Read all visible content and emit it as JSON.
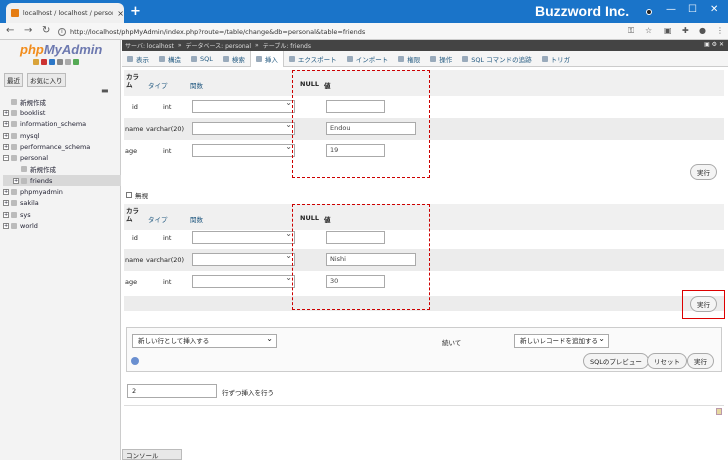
{
  "browser": {
    "tab_title": "localhost / localhost / personal /",
    "url": "http://localhost/phpMyAdmin/index.php?route=/table/change&db=personal&table=friends",
    "brand": "Buzzword Inc."
  },
  "sidebar": {
    "logo_php": "php",
    "logo_admin": "MyAdmin",
    "recent": "最近",
    "favorites": "お気に入り",
    "tree": [
      {
        "label": "新規作成",
        "level": 0,
        "pm": "",
        "selected": false
      },
      {
        "label": "booklist",
        "level": 0,
        "pm": "+",
        "selected": false
      },
      {
        "label": "information_schema",
        "level": 0,
        "pm": "+",
        "selected": false
      },
      {
        "label": "mysql",
        "level": 0,
        "pm": "+",
        "selected": false
      },
      {
        "label": "performance_schema",
        "level": 0,
        "pm": "+",
        "selected": false
      },
      {
        "label": "personal",
        "level": 0,
        "pm": "−",
        "selected": false
      },
      {
        "label": "新規作成",
        "level": 1,
        "pm": "",
        "selected": false
      },
      {
        "label": "friends",
        "level": 1,
        "pm": "+",
        "selected": true
      },
      {
        "label": "phpmyadmin",
        "level": 0,
        "pm": "+",
        "selected": false
      },
      {
        "label": "sakila",
        "level": 0,
        "pm": "+",
        "selected": false
      },
      {
        "label": "sys",
        "level": 0,
        "pm": "+",
        "selected": false
      },
      {
        "label": "world",
        "level": 0,
        "pm": "+",
        "selected": false
      }
    ]
  },
  "breadcrumb": {
    "server": "サーバ: localhost",
    "db": "データベース: personal",
    "table": "テーブル: friends"
  },
  "tabs": [
    "表示",
    "構造",
    "SQL",
    "検索",
    "挿入",
    "エクスポート",
    "インポート",
    "権限",
    "操作",
    "SQL コマンドの追跡",
    "トリガ"
  ],
  "form": {
    "col_header": "カラム",
    "type_header": "タイプ",
    "func_header": "関数",
    "null_header": "NULL",
    "value_header": "値",
    "execute": "実行",
    "ignore": "無視",
    "rows1": [
      {
        "name": "id",
        "type": "int",
        "value": ""
      },
      {
        "name": "name",
        "type": "varchar(20)",
        "value": "Endou"
      },
      {
        "name": "age",
        "type": "int",
        "value": "19"
      }
    ],
    "rows2": [
      {
        "name": "id",
        "type": "int",
        "value": ""
      },
      {
        "name": "name",
        "type": "varchar(20)",
        "value": "Nishi"
      },
      {
        "name": "age",
        "type": "int",
        "value": "30"
      }
    ]
  },
  "bottom": {
    "insert_as": "新しい行として挿入する",
    "continue_label": "続いて",
    "then": "新しいレコードを追加する",
    "preview": "SQLのプレビュー",
    "reset": "リセット",
    "execute": "実行",
    "rows_count": "2",
    "rows_suffix": "行ずつ挿入を行う",
    "console": "コンソール"
  }
}
